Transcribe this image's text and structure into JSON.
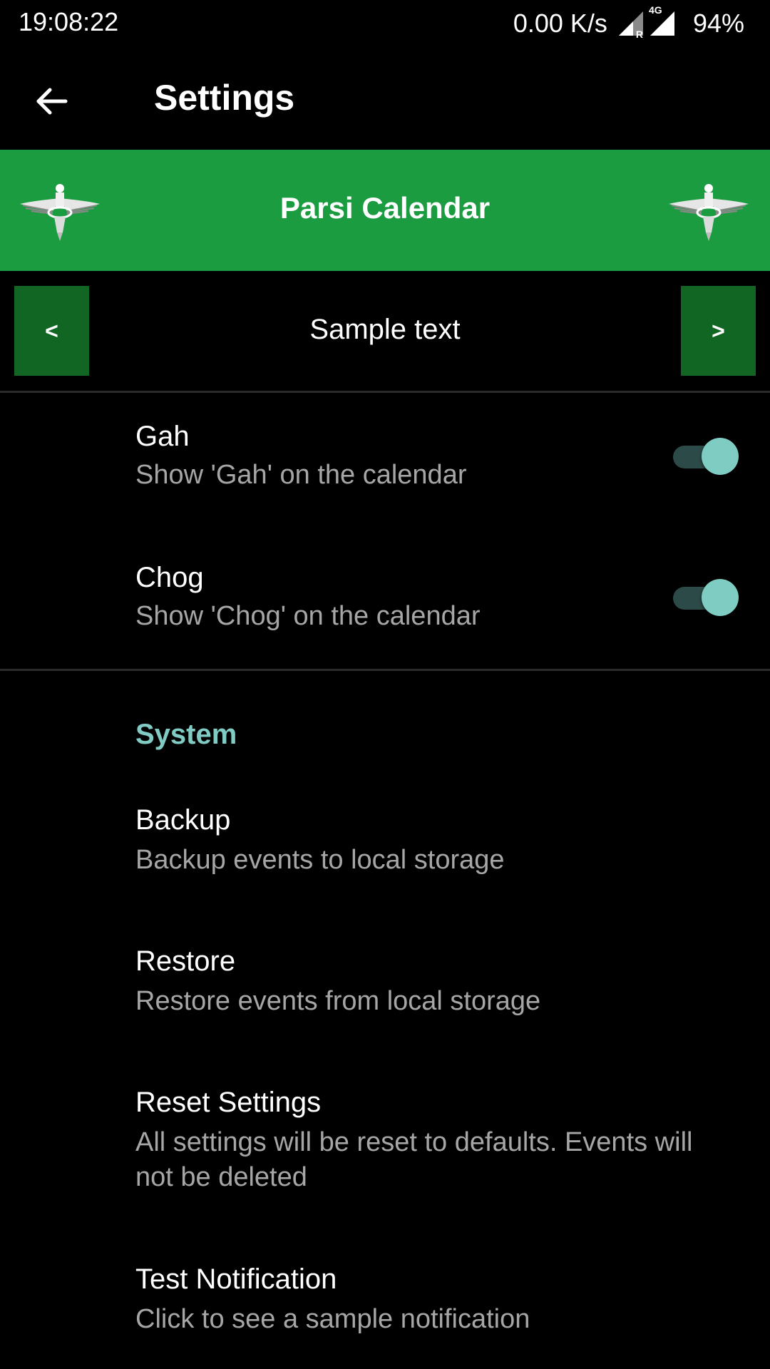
{
  "status_bar": {
    "time": "19:08:22",
    "net_speed": "0.00 K/s",
    "sim1_tag": "R",
    "sim2_tag": "4G",
    "battery": "94%"
  },
  "app_bar": {
    "back_icon": "arrow-left-icon",
    "title": "Settings"
  },
  "banner": {
    "title": "Parsi Calendar",
    "emblem_icon": "faravahar-icon",
    "color": "#1c9c40"
  },
  "sample_nav": {
    "prev_label": "<",
    "next_label": ">",
    "text": "Sample text",
    "button_color": "#126624"
  },
  "display_prefs": [
    {
      "title": "Gah",
      "summary": "Show 'Gah' on the calendar",
      "enabled": true
    },
    {
      "title": "Chog",
      "summary": "Show 'Chog' on the calendar",
      "enabled": true
    }
  ],
  "system": {
    "header": "System",
    "header_color": "#80cbc4",
    "items": [
      {
        "title": "Backup",
        "summary": "Backup events to local storage"
      },
      {
        "title": "Restore",
        "summary": "Restore events from local storage"
      },
      {
        "title": "Reset Settings",
        "summary": "All settings will be reset to defaults. Events will not be deleted"
      },
      {
        "title": "Test Notification",
        "summary": "Click to see a sample notification"
      }
    ]
  },
  "colors": {
    "accent": "#80cbc4",
    "background": "#000000",
    "summary_text": "#a6a6a6"
  }
}
